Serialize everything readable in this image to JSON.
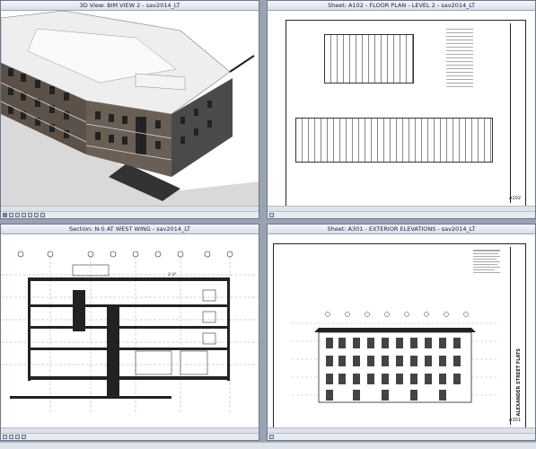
{
  "windows": {
    "top_left": {
      "title": "3D View: BIM VIEW 2 - sav2014_LT"
    },
    "top_right": {
      "title": "Sheet: A102 - FLOOR PLAN - LEVEL 2 - sav2014_LT",
      "sheet_number": "A102"
    },
    "bottom_left": {
      "title": "Section: N-S  AT WEST WING - sav2014_LT",
      "dimension": "3'-0\""
    },
    "bottom_right": {
      "title": "Sheet: A301 - EXTERIOR ELEVATIONS - sav2014_LT",
      "sheet_number": "A301",
      "project_name": "ALEXANDER STREET FLATS"
    }
  },
  "icons": [
    "view-control-icon",
    "scroll-arrow-icon"
  ],
  "colors": {
    "window_border": "#6d7788",
    "title_bar": "#dfe3ea",
    "drawing_line": "#222222"
  }
}
